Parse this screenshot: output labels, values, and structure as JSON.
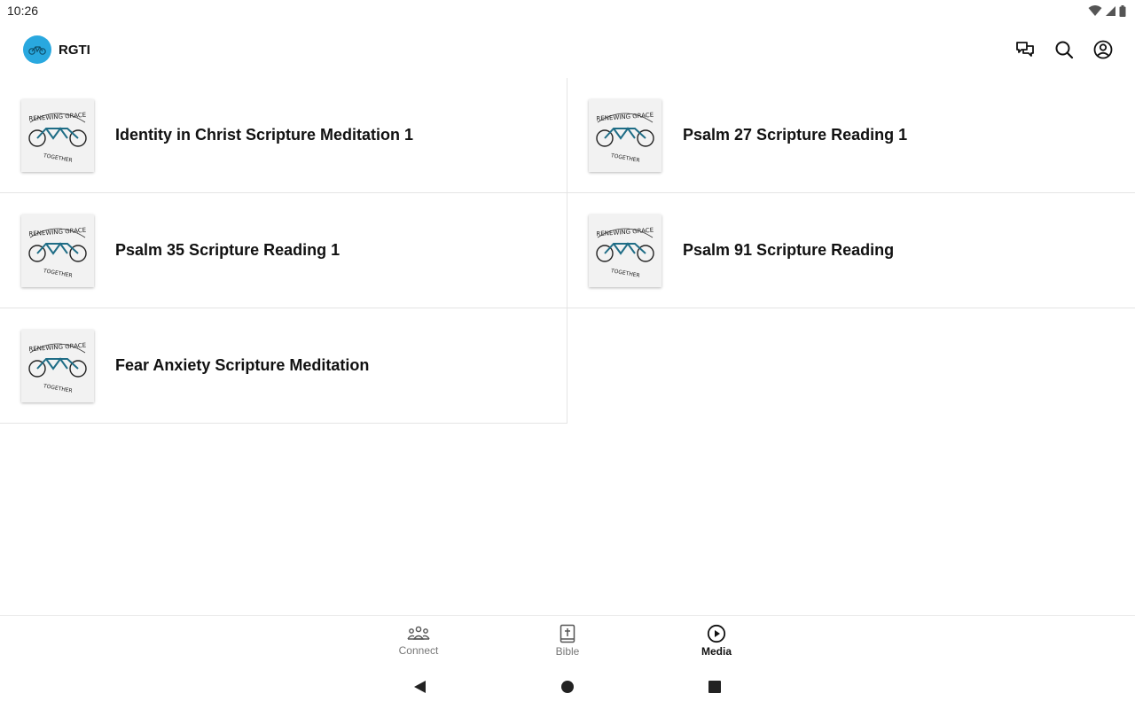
{
  "status_bar": {
    "time": "10:26"
  },
  "app_bar": {
    "brand_name": "RGTI",
    "actions": [
      {
        "icon": "chat-icon",
        "label": "Messages"
      },
      {
        "icon": "search-icon",
        "label": "Search"
      },
      {
        "icon": "account-icon",
        "label": "Account"
      }
    ]
  },
  "media_items": [
    {
      "title": "Identity in Christ Scripture Meditation 1",
      "thumb_text": "RENEWING GRACE TOGETHER"
    },
    {
      "title": "Psalm 27 Scripture Reading 1",
      "thumb_text": "RENEWING GRACE TOGETHER"
    },
    {
      "title": "Psalm 35 Scripture Reading 1",
      "thumb_text": "RENEWING GRACE TOGETHER"
    },
    {
      "title": "Psalm 91 Scripture Reading",
      "thumb_text": "RENEWING GRACE TOGETHER"
    },
    {
      "title": "Fear Anxiety Scripture Meditation",
      "thumb_text": "RENEWING GRACE TOGETHER"
    }
  ],
  "bottom_nav": {
    "tabs": [
      {
        "label": "Connect",
        "icon": "people-icon",
        "active": false
      },
      {
        "label": "Bible",
        "icon": "bible-icon",
        "active": false
      },
      {
        "label": "Media",
        "icon": "play-circle-icon",
        "active": true
      }
    ]
  },
  "colors": {
    "brand": "#29a8df",
    "bike": "#1f6d86",
    "text": "#111111",
    "divider": "#e4e4e4"
  }
}
